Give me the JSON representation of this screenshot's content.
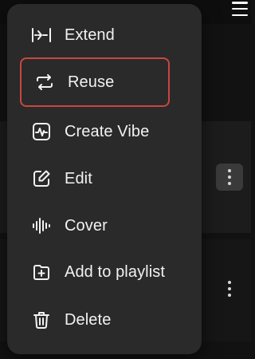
{
  "menu": {
    "items": [
      {
        "label": "Extend",
        "icon": "extend-icon"
      },
      {
        "label": "Reuse",
        "icon": "reuse-icon",
        "selected": true
      },
      {
        "label": "Create Vibe",
        "icon": "create-vibe-icon"
      },
      {
        "label": "Edit",
        "icon": "edit-icon"
      },
      {
        "label": "Cover",
        "icon": "cover-icon"
      },
      {
        "label": "Add to playlist",
        "icon": "add-to-playlist-icon"
      },
      {
        "label": "Delete",
        "icon": "delete-icon"
      }
    ]
  },
  "colors": {
    "menu_bg": "#2a2a2a",
    "selected_outline": "#c9473d",
    "text": "#f2f2f2",
    "page_bg": "#121212"
  }
}
